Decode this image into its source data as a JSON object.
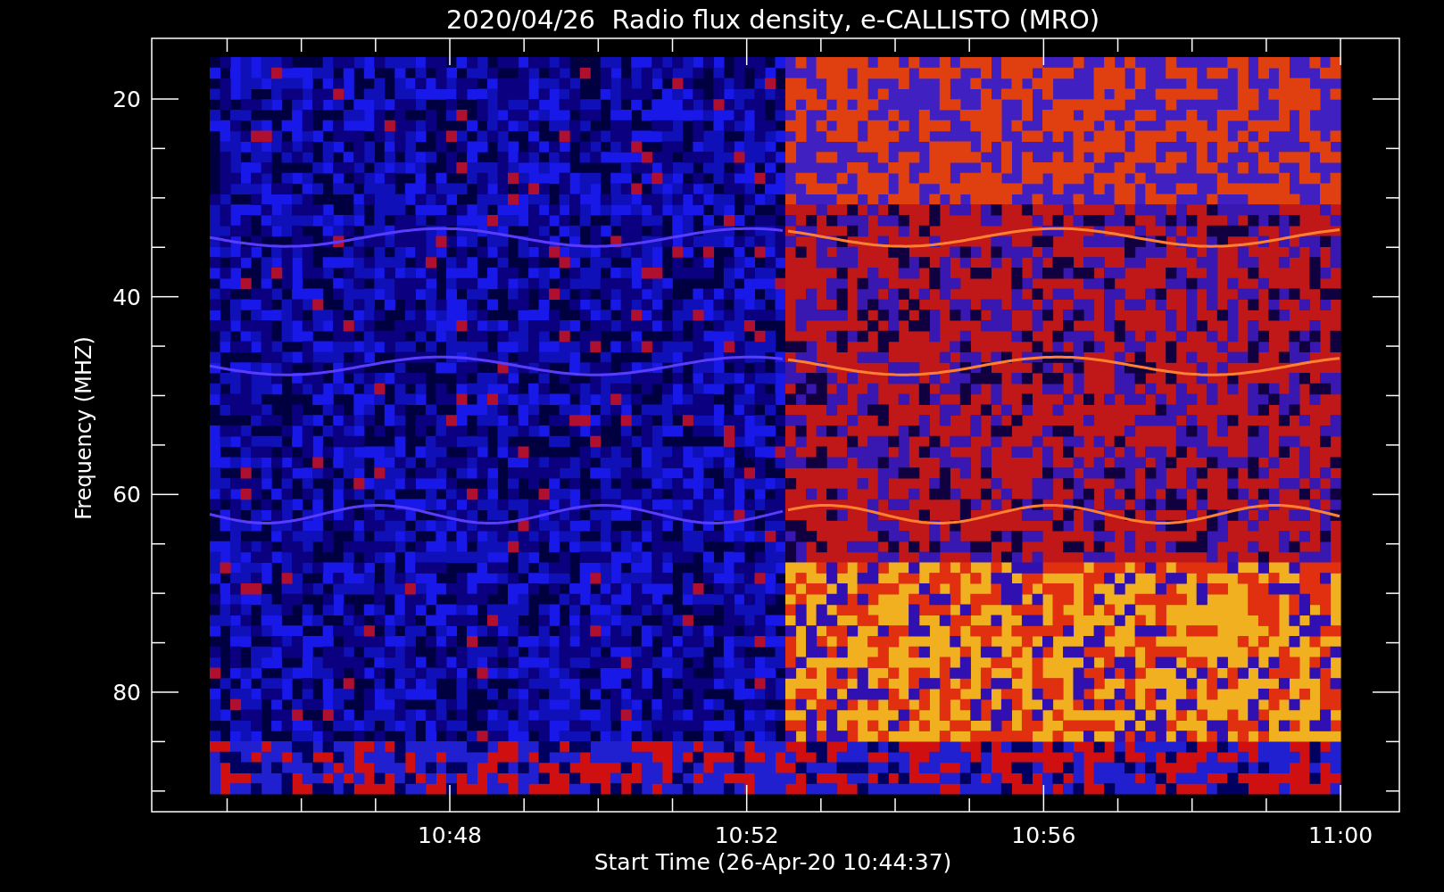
{
  "title": "2020/04/26  Radio flux density, e-CALLISTO (MRO)",
  "y_axis": {
    "label": "Frequency (MHZ)",
    "ticks": [
      "20",
      "40",
      "60",
      "80"
    ]
  },
  "x_axis": {
    "label": "Start Time (26-Apr-20 10:44:37)",
    "ticks": [
      "10:48",
      "10:52",
      "10:56",
      "11:00"
    ]
  }
}
